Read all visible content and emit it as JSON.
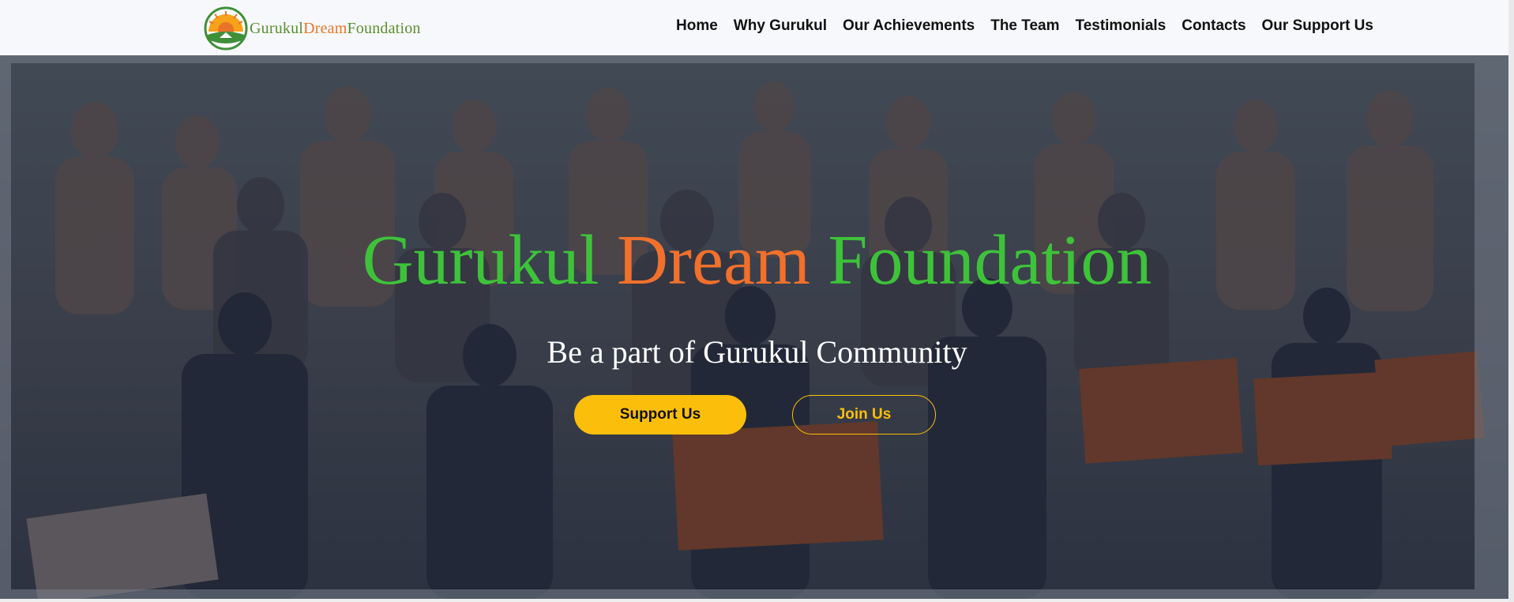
{
  "brand": {
    "logo_part1": "Gurukul",
    "logo_part2": "Dream",
    "logo_part3": "Foundation",
    "logo_icon": "sunrise-logo-icon",
    "colors": {
      "green": "#5a8f2e",
      "orange": "#e8742a"
    }
  },
  "nav": {
    "items": [
      {
        "label": "Home"
      },
      {
        "label": "Why Gurukul"
      },
      {
        "label": "Our Achievements"
      },
      {
        "label": "The Team"
      },
      {
        "label": "Testimonials"
      },
      {
        "label": "Contacts"
      },
      {
        "label": "Our Support Us"
      }
    ]
  },
  "hero": {
    "title_part1": "Gurukul",
    "title_part2": "Dream",
    "title_part3": "Foundation",
    "subtitle": "Be a part of Gurukul Community",
    "support_button": "Support Us",
    "join_button": "Join Us",
    "colors": {
      "title_green": "#3ec23a",
      "title_orange": "#f0702c",
      "button_yellow": "#fbbf0b"
    }
  }
}
